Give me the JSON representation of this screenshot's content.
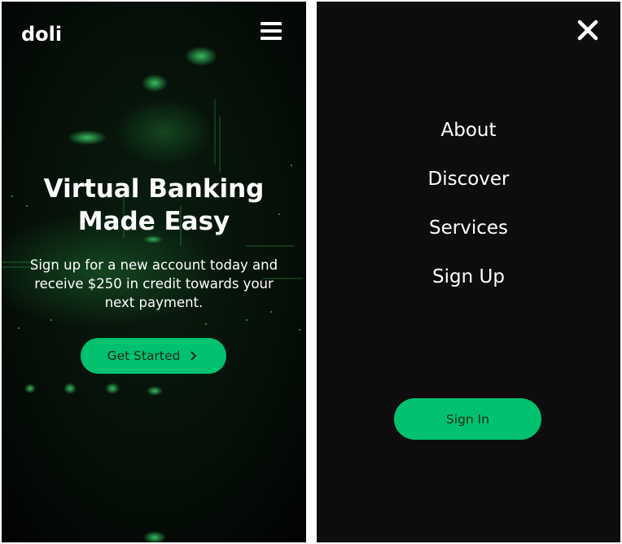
{
  "brand": {
    "logo_text": "doli",
    "accent_color": "#00c26e",
    "background_color": "#050805"
  },
  "header": {
    "menu_icon": "hamburger-menu-icon"
  },
  "hero": {
    "title_line1": "Virtual Banking",
    "title_line2": "Made Easy",
    "subtitle": "Sign up for a new account today and receive $250 in credit towards your next payment.",
    "cta_label": "Get Started",
    "cta_icon": "chevron-right-icon"
  },
  "menu": {
    "close_icon": "close-icon",
    "items": [
      {
        "label": "About"
      },
      {
        "label": "Discover"
      },
      {
        "label": "Services"
      },
      {
        "label": "Sign Up"
      }
    ],
    "signin_label": "Sign In"
  }
}
